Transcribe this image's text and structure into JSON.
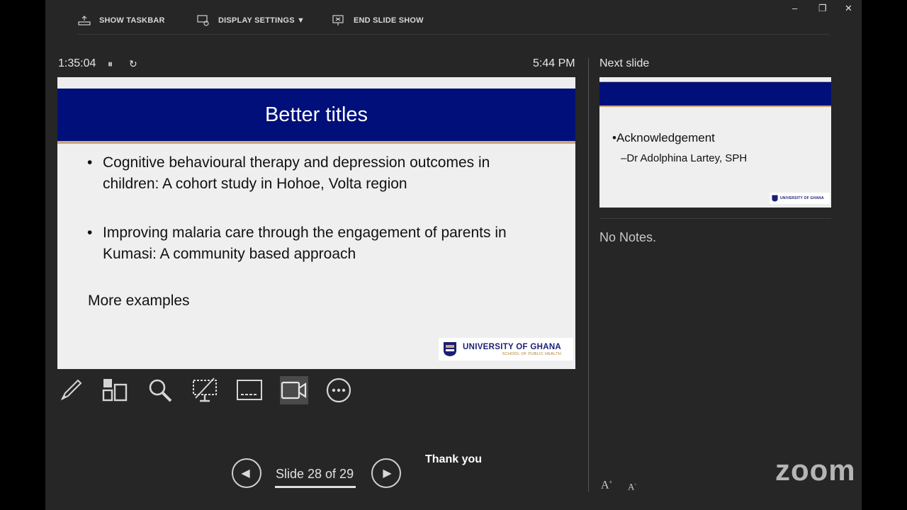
{
  "toolbar": {
    "show_taskbar": "SHOW TASKBAR",
    "display_settings": "DISPLAY SETTINGS ▼",
    "end_slide_show": "END SLIDE SHOW"
  },
  "window_controls": {
    "minimize": "–",
    "restore": "❐",
    "close": "✕"
  },
  "timer": {
    "elapsed": "1:35:04",
    "pause_glyph": "⏸",
    "reset_glyph": "↻"
  },
  "clock": "5:44 PM",
  "current_slide": {
    "title": "Better titles",
    "bullets": [
      {
        "line1": "Cognitive behavioural therapy and depression outcomes in",
        "line2": "children:  A cohort study in Hohoe, Volta region"
      },
      {
        "line1": "Improving malaria care through the engagement of parents in",
        "line2": "Kumasi: A community based approach"
      }
    ],
    "bullet_glyph": "•",
    "more_text": "More examples",
    "logo_name": "UNIVERSITY OF GHANA",
    "logo_sub": "SCHOOL OF PUBLIC HEALTH"
  },
  "tools": [
    "pen-icon",
    "grid-icon",
    "zoom-icon",
    "laser-icon",
    "subtitles-icon",
    "camera-icon",
    "more-icon"
  ],
  "navigation": {
    "slide_indicator": "Slide 28 of 29",
    "prev_glyph": "◀",
    "next_glyph": "▶"
  },
  "chat_overlay": "Thank you",
  "next_slide": {
    "label": "Next slide",
    "line1": "•Acknowledgement",
    "line2": "–Dr Adolphina Lartey, SPH",
    "logo_name": "UNIVERSITY OF GHANA"
  },
  "notes": "No Notes.",
  "font_controls": {
    "increase": "A",
    "decrease": "A"
  },
  "watermark": "zoom",
  "colors": {
    "slide_band": "#000f7a",
    "accent_gold": "#c9a77e",
    "logo_navy": "#1a1f73"
  }
}
